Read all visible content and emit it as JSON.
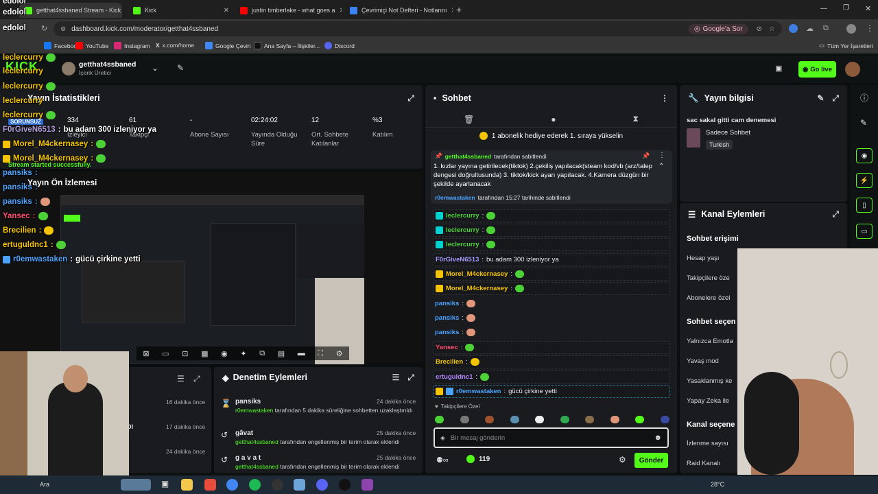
{
  "browser": {
    "tabs": [
      {
        "label": "getthat4ssbaned Stream - Kick",
        "color": "#53fc18"
      },
      {
        "label": "Kick",
        "color": "#53fc18"
      },
      {
        "label": "justin timberlake - what goes a",
        "color": "#ff0000"
      },
      {
        "label": "Çevrimiçi Not Defteri - Notlarını",
        "color": "#3b82f6"
      }
    ],
    "new_tab": "+",
    "url": "dashboard.kick.com/moderator/getthat4ssbaned",
    "google_button": "Google'a Sor",
    "bookmarks": [
      "Facebook",
      "YouTube",
      "Instagram",
      "x.com/home",
      "Google Çeviri",
      "Ana Sayfa – İlişkiler...",
      "Discord"
    ],
    "all_bookmarks": "Tüm Yer İşaretleri"
  },
  "header": {
    "username": "getthat4ssbaned",
    "role": "İçerik Üretici",
    "go_live": "Go live"
  },
  "stats": {
    "title": "Yayın İstatistikleri",
    "items": [
      {
        "value": "334",
        "label": "İzleyici"
      },
      {
        "value": "61",
        "label": "Takipçi"
      },
      {
        "value": "-",
        "label": "Abone Sayısı"
      },
      {
        "value": "02:24:02",
        "label": "Yayında Olduğu Süre"
      },
      {
        "value": "12",
        "label": "Ort. Sohbete Katılanlar"
      },
      {
        "value": "%3",
        "label": "Katılım"
      }
    ]
  },
  "preview": {
    "title": "Yayın Ön İzlemesi"
  },
  "mod_actions": {
    "title": "Denetim Eylemleri",
    "items": [
      {
        "user": "pansiks",
        "time": "24 dakika önce",
        "actor": "r0emwastaken",
        "text": "tarafından 5 dakika süreliğine sohbetten uzaklaştırıldı"
      },
      {
        "user": "gâvat",
        "time": "25 dakika önce",
        "actor": "getthat4ssbaned",
        "text": "tarafından engellenmiş bir terim olarak eklendi"
      },
      {
        "user": "g a v a t",
        "time": "25 dakika önce",
        "actor": "getthat4ssbaned",
        "text": "tarafından engellenmiş bir terim olarak eklendi"
      }
    ],
    "left_times": [
      "16 dakika önce",
      "17 dakika önce",
      "24 dakika önce"
    ],
    "left_fragment": "DI"
  },
  "chat": {
    "title": "Sohbet",
    "gift_banner": "1 abonelik hediye ederek 1. sıraya yükselin",
    "pinned": {
      "user": "getthat4ssbaned",
      "suffix": "tarafından sabitlendi",
      "text": "1. kızlar yayına getirilecek(tiktok) 2.çekiliş yapılacak(steam kod/vb (arz/talep dengesi doğrultusunda) 3. tiktok/kick ayarı yapılacak. 4.Kamera düzgün bir şekilde ayarlanacak",
      "by": "r0emwastaken",
      "by_suffix": "tarafından 15:27 tarihinde sabitlendi"
    },
    "messages": [
      {
        "user": "leclercurry",
        "color": "#4cd137",
        "text": ""
      },
      {
        "user": "leclercurry",
        "color": "#4cd137",
        "text": ""
      },
      {
        "user": "leclercurry",
        "color": "#4cd137",
        "text": ""
      },
      {
        "user": "F0rGiveN6513",
        "color": "#a29bfe",
        "text": "bu adam 300 izleniyor ya"
      },
      {
        "user": "Morel_M4ckernasey",
        "color": "#f5c400",
        "text": ""
      },
      {
        "user": "Morel_M4ckernasey",
        "color": "#f5c400",
        "text": ""
      },
      {
        "user": "pansiks",
        "color": "#4aa3ff",
        "text": ""
      },
      {
        "user": "pansiks",
        "color": "#4aa3ff",
        "text": ""
      },
      {
        "user": "pansiks",
        "color": "#4aa3ff",
        "text": ""
      },
      {
        "user": "Yansec",
        "color": "#ff4d6d",
        "text": ""
      },
      {
        "user": "Brecilien",
        "color": "#f5c400",
        "text": ""
      },
      {
        "user": "ertuguldnc1",
        "color": "#b388ff",
        "text": ""
      },
      {
        "user": "r0emwastaken",
        "color": "#4aa3ff",
        "text": "gücü çirkine yetti"
      }
    ],
    "emote_tab": "Takipçilere Özel",
    "input_placeholder": "Bir mesaj gönderin",
    "points": "119",
    "send": "Gönder"
  },
  "stream_info": {
    "title": "Yayın bilgisi",
    "stream_title": "sac sakal gitti cam denemesi",
    "category": "Sadece Sohbet",
    "language": "Turkish"
  },
  "channel_actions": {
    "title": "Kanal Eylemleri",
    "sections": [
      {
        "head": "Sohbet erişimi",
        "items": [
          "Hesap yaşı",
          "Takipçilere öze",
          "Abonelere özel"
        ]
      },
      {
        "head": "Sohbet seçen",
        "items": [
          "Yalnızca Emotla",
          "Yavaş mod",
          "Yasaklanmış ke",
          "Yapay Zeka ile"
        ]
      },
      {
        "head": "Kanal seçene",
        "items": [
          "İzlenme sayısı",
          "Raid Kanalı"
        ]
      }
    ]
  },
  "overlay": {
    "lines": [
      {
        "user": "edolol",
        "text": "",
        "color": "#ffffff"
      },
      {
        "user": "edolol",
        "text": "",
        "color": "#ffffff"
      },
      {
        "user": "edolol",
        "text": "",
        "color": "#ffffff"
      },
      {
        "user": "leclercurry",
        "text": "",
        "color": "#f5c400"
      },
      {
        "user": "leclercurry",
        "text": "",
        "color": "#f5c400"
      },
      {
        "user": "leclercurry",
        "text": "",
        "color": "#f5c400"
      },
      {
        "user": "leclercurry",
        "text": "",
        "color": "#f5c400"
      },
      {
        "user": "leclercurry",
        "text": "",
        "color": "#f5c400"
      },
      {
        "user": "F0rGiveN6513",
        "text": "bu adam 300 izleniyor ya",
        "color": "#b39ddb"
      },
      {
        "user": "Morel_M4ckernasey",
        "text": "",
        "color": "#f5c400"
      },
      {
        "user": "Morel_M4ckernasey",
        "text": "",
        "color": "#f5c400"
      },
      {
        "user": "pansiks",
        "text": "",
        "color": "#4aa3ff"
      },
      {
        "user": "pansiks",
        "text": "",
        "color": "#4aa3ff"
      },
      {
        "user": "pansiks",
        "text": "",
        "color": "#4aa3ff"
      },
      {
        "user": "Yansec",
        "text": "",
        "color": "#ff4d6d"
      },
      {
        "user": "Brecilien",
        "text": "",
        "color": "#f5c400"
      },
      {
        "user": "ertuguldnc1",
        "text": "",
        "color": "#f5c400"
      },
      {
        "user": "r0emwastaken",
        "text": "gücü çirkine yetti",
        "color": "#4aa3ff"
      }
    ],
    "sorunsuz": "SORUNSUZ",
    "started": "Stream started successfully."
  },
  "taskbar": {
    "weather": "28°C",
    "fragment": "Ara"
  }
}
